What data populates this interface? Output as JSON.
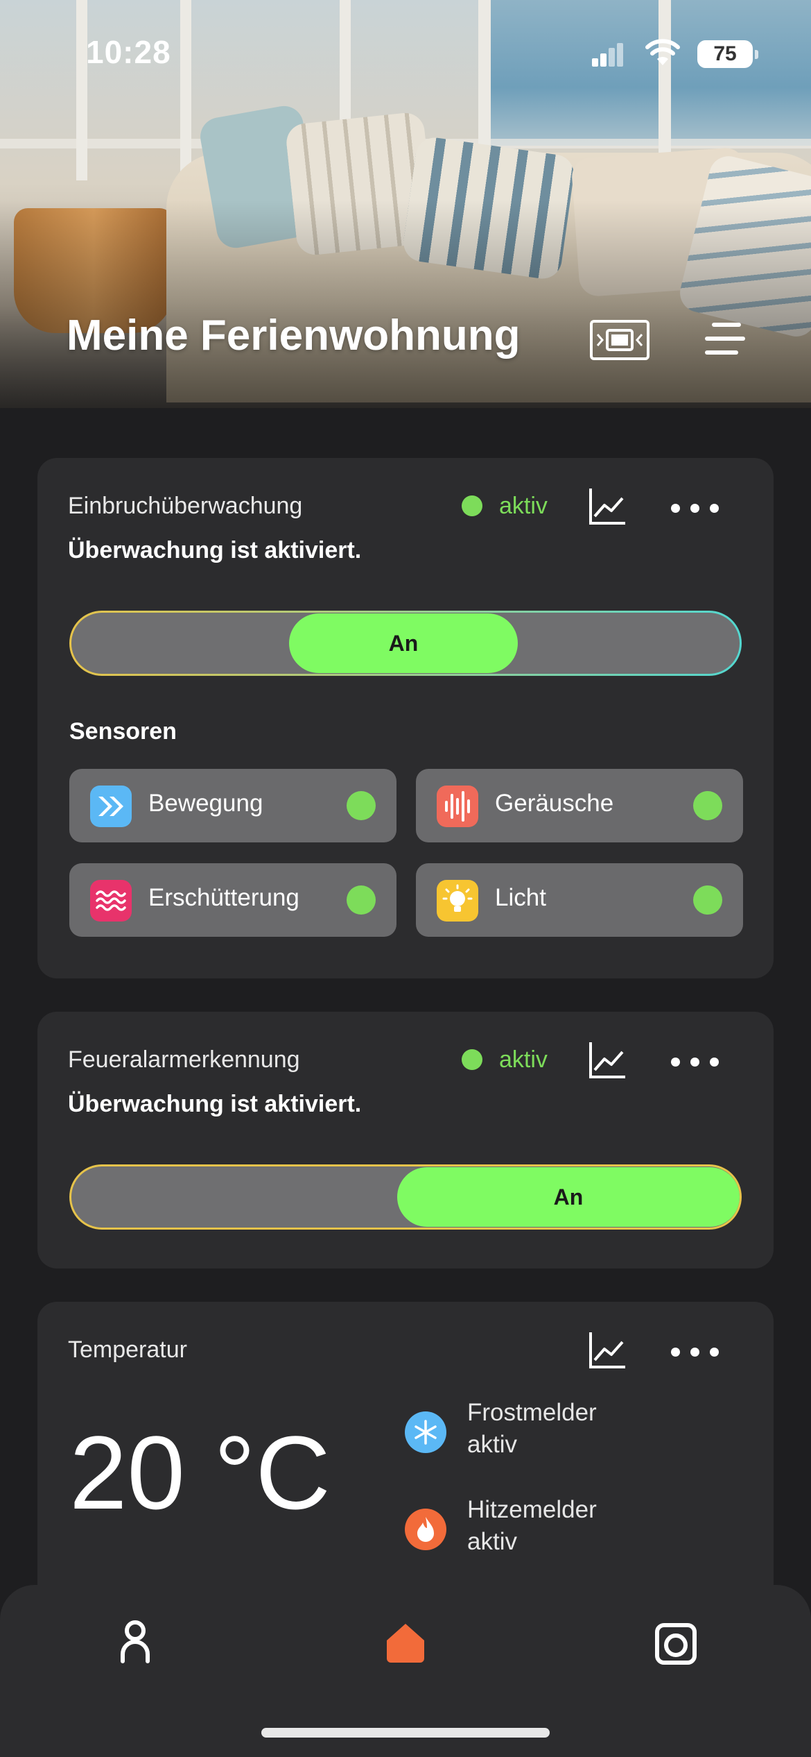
{
  "status_bar": {
    "time": "10:28",
    "battery": "75"
  },
  "header": {
    "title": "Meine Ferienwohnung"
  },
  "intrusion": {
    "title": "Einbruchüberwachung",
    "status": "aktiv",
    "subtitle": "Überwachung ist aktiviert.",
    "toggle_label": "An",
    "sensors_label": "Sensoren",
    "sensors": [
      {
        "label": "Bewegung",
        "icon": "motion-icon",
        "color": "#5bb8f5"
      },
      {
        "label": "Geräusche",
        "icon": "sound-wave-icon",
        "color": "#f06a5a"
      },
      {
        "label": "Erschütterung",
        "icon": "vibration-icon",
        "color": "#e8336b"
      },
      {
        "label": "Licht",
        "icon": "lightbulb-icon",
        "color": "#f7c531"
      }
    ]
  },
  "fire": {
    "title": "Feueralarmerkennung",
    "status": "aktiv",
    "subtitle": "Überwachung ist aktiviert.",
    "toggle_label": "An"
  },
  "temperature": {
    "title": "Temperatur",
    "value": "20 °C",
    "frost": {
      "name": "Frostmelder",
      "state": "aktiv",
      "icon": "snowflake-icon",
      "color": "#5bb8f5"
    },
    "heat": {
      "name": "Hitzemelder",
      "state": "aktiv",
      "icon": "flame-icon",
      "color": "#f26b3a"
    }
  },
  "nav": {
    "items": [
      {
        "icon": "profile-icon"
      },
      {
        "icon": "home-icon",
        "active_color": "#f26b3a"
      },
      {
        "icon": "camera-icon"
      }
    ]
  },
  "colors": {
    "accent_green": "#7ffb62",
    "status_green": "#7ddc5a",
    "card_bg": "#2c2c2e"
  }
}
